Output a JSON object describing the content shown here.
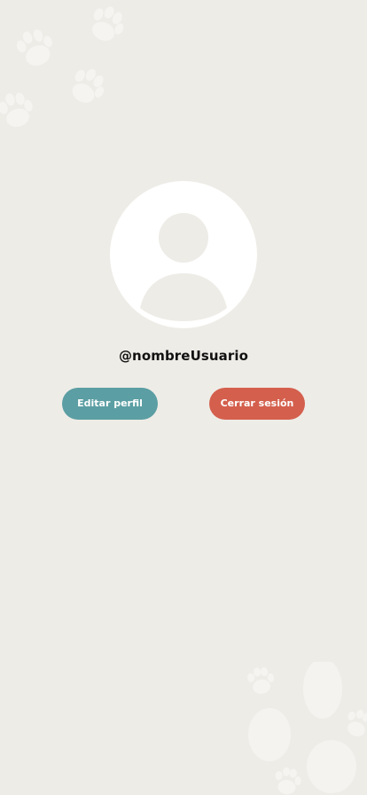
{
  "profile": {
    "username": "@nombreUsuario"
  },
  "actions": {
    "edit_label": "Editar perfil",
    "logout_label": "Cerrar sesión"
  },
  "colors": {
    "background": "#eeece7",
    "edit_button": "#5b9ea3",
    "logout_button": "#d45f4d",
    "avatar_bg": "#ffffff",
    "avatar_figure": "#eeece7"
  },
  "icons": {
    "avatar": "user-silhouette-icon",
    "decoration": "paw-print-icon"
  }
}
